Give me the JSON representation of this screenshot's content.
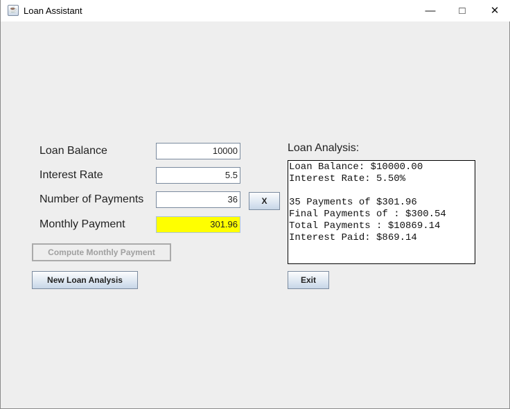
{
  "window": {
    "title": "Loan Assistant",
    "icon": "java-cup-icon",
    "controls": [
      "minimize",
      "maximize",
      "close"
    ]
  },
  "form": {
    "loan_balance": {
      "label": "Loan Balance",
      "value": "10000"
    },
    "interest_rate": {
      "label": "Interest Rate",
      "value": "5.5"
    },
    "num_payments": {
      "label": "Number of Payments",
      "value": "36"
    },
    "monthly_payment": {
      "label": "Monthly Payment",
      "value": "301.96",
      "highlight": "#ffff00"
    },
    "x_button": "X",
    "compute_button": "Compute Monthly Payment",
    "new_analysis_button": "New Loan Analysis"
  },
  "analysis": {
    "label": "Loan Analysis:",
    "lines": [
      "Loan Balance: $10000.00",
      "Interest Rate: 5.50%",
      "",
      "35 Payments of $301.96",
      "Final Payments of : $300.54",
      "Total Payments : $10869.14",
      "Interest Paid: $869.14"
    ],
    "exit_button": "Exit"
  }
}
